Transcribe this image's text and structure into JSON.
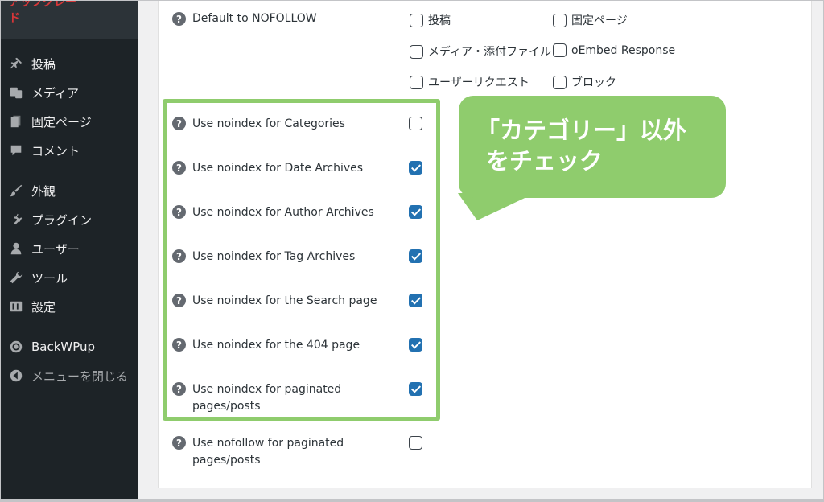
{
  "sidebar": {
    "top_line1": "アップグレー",
    "top_line2": "ド",
    "items": [
      {
        "label": "投稿",
        "icon": "pin-icon"
      },
      {
        "label": "メディア",
        "icon": "media-icon"
      },
      {
        "label": "固定ページ",
        "icon": "page-icon"
      },
      {
        "label": "コメント",
        "icon": "comment-icon"
      },
      {
        "label": "外観",
        "icon": "paintbrush-icon"
      },
      {
        "label": "プラグイン",
        "icon": "plugin-icon"
      },
      {
        "label": "ユーザー",
        "icon": "user-icon"
      },
      {
        "label": "ツール",
        "icon": "wrench-icon"
      },
      {
        "label": "設定",
        "icon": "settings-icon"
      },
      {
        "label": "BackWPup",
        "icon": "backwpup-icon"
      },
      {
        "label": "メニューを閉じる",
        "icon": "collapse-icon"
      }
    ]
  },
  "nofollow": {
    "label": "Default to NOFOLLOW",
    "options": [
      {
        "label": "投稿",
        "checked": false
      },
      {
        "label": "固定ページ",
        "checked": false
      },
      {
        "label": "メディア・添付ファイル",
        "checked": false
      },
      {
        "label": "oEmbed Response",
        "checked": false
      },
      {
        "label": "ユーザーリクエスト",
        "checked": false
      },
      {
        "label": "ブロック",
        "checked": false
      }
    ]
  },
  "settings": [
    {
      "label": "Use noindex for Categories",
      "checked": false
    },
    {
      "label": "Use noindex for Date Archives",
      "checked": true
    },
    {
      "label": "Use noindex for Author Archives",
      "checked": true
    },
    {
      "label": "Use noindex for Tag Archives",
      "checked": true
    },
    {
      "label": "Use noindex for the Search page",
      "checked": true
    },
    {
      "label": "Use noindex for the 404 page",
      "checked": true
    },
    {
      "label": "Use noindex for paginated pages/posts",
      "checked": true
    },
    {
      "label": "Use nofollow for paginated pages/posts",
      "checked": false
    }
  ],
  "help_glyph": "?",
  "callout": {
    "line1": "「カテゴリー」以外",
    "line2": "をチェック"
  },
  "colors": {
    "sidebar_bg": "#1d2327",
    "checkbox_checked": "#2271b1",
    "highlight": "#8fcc6d"
  }
}
